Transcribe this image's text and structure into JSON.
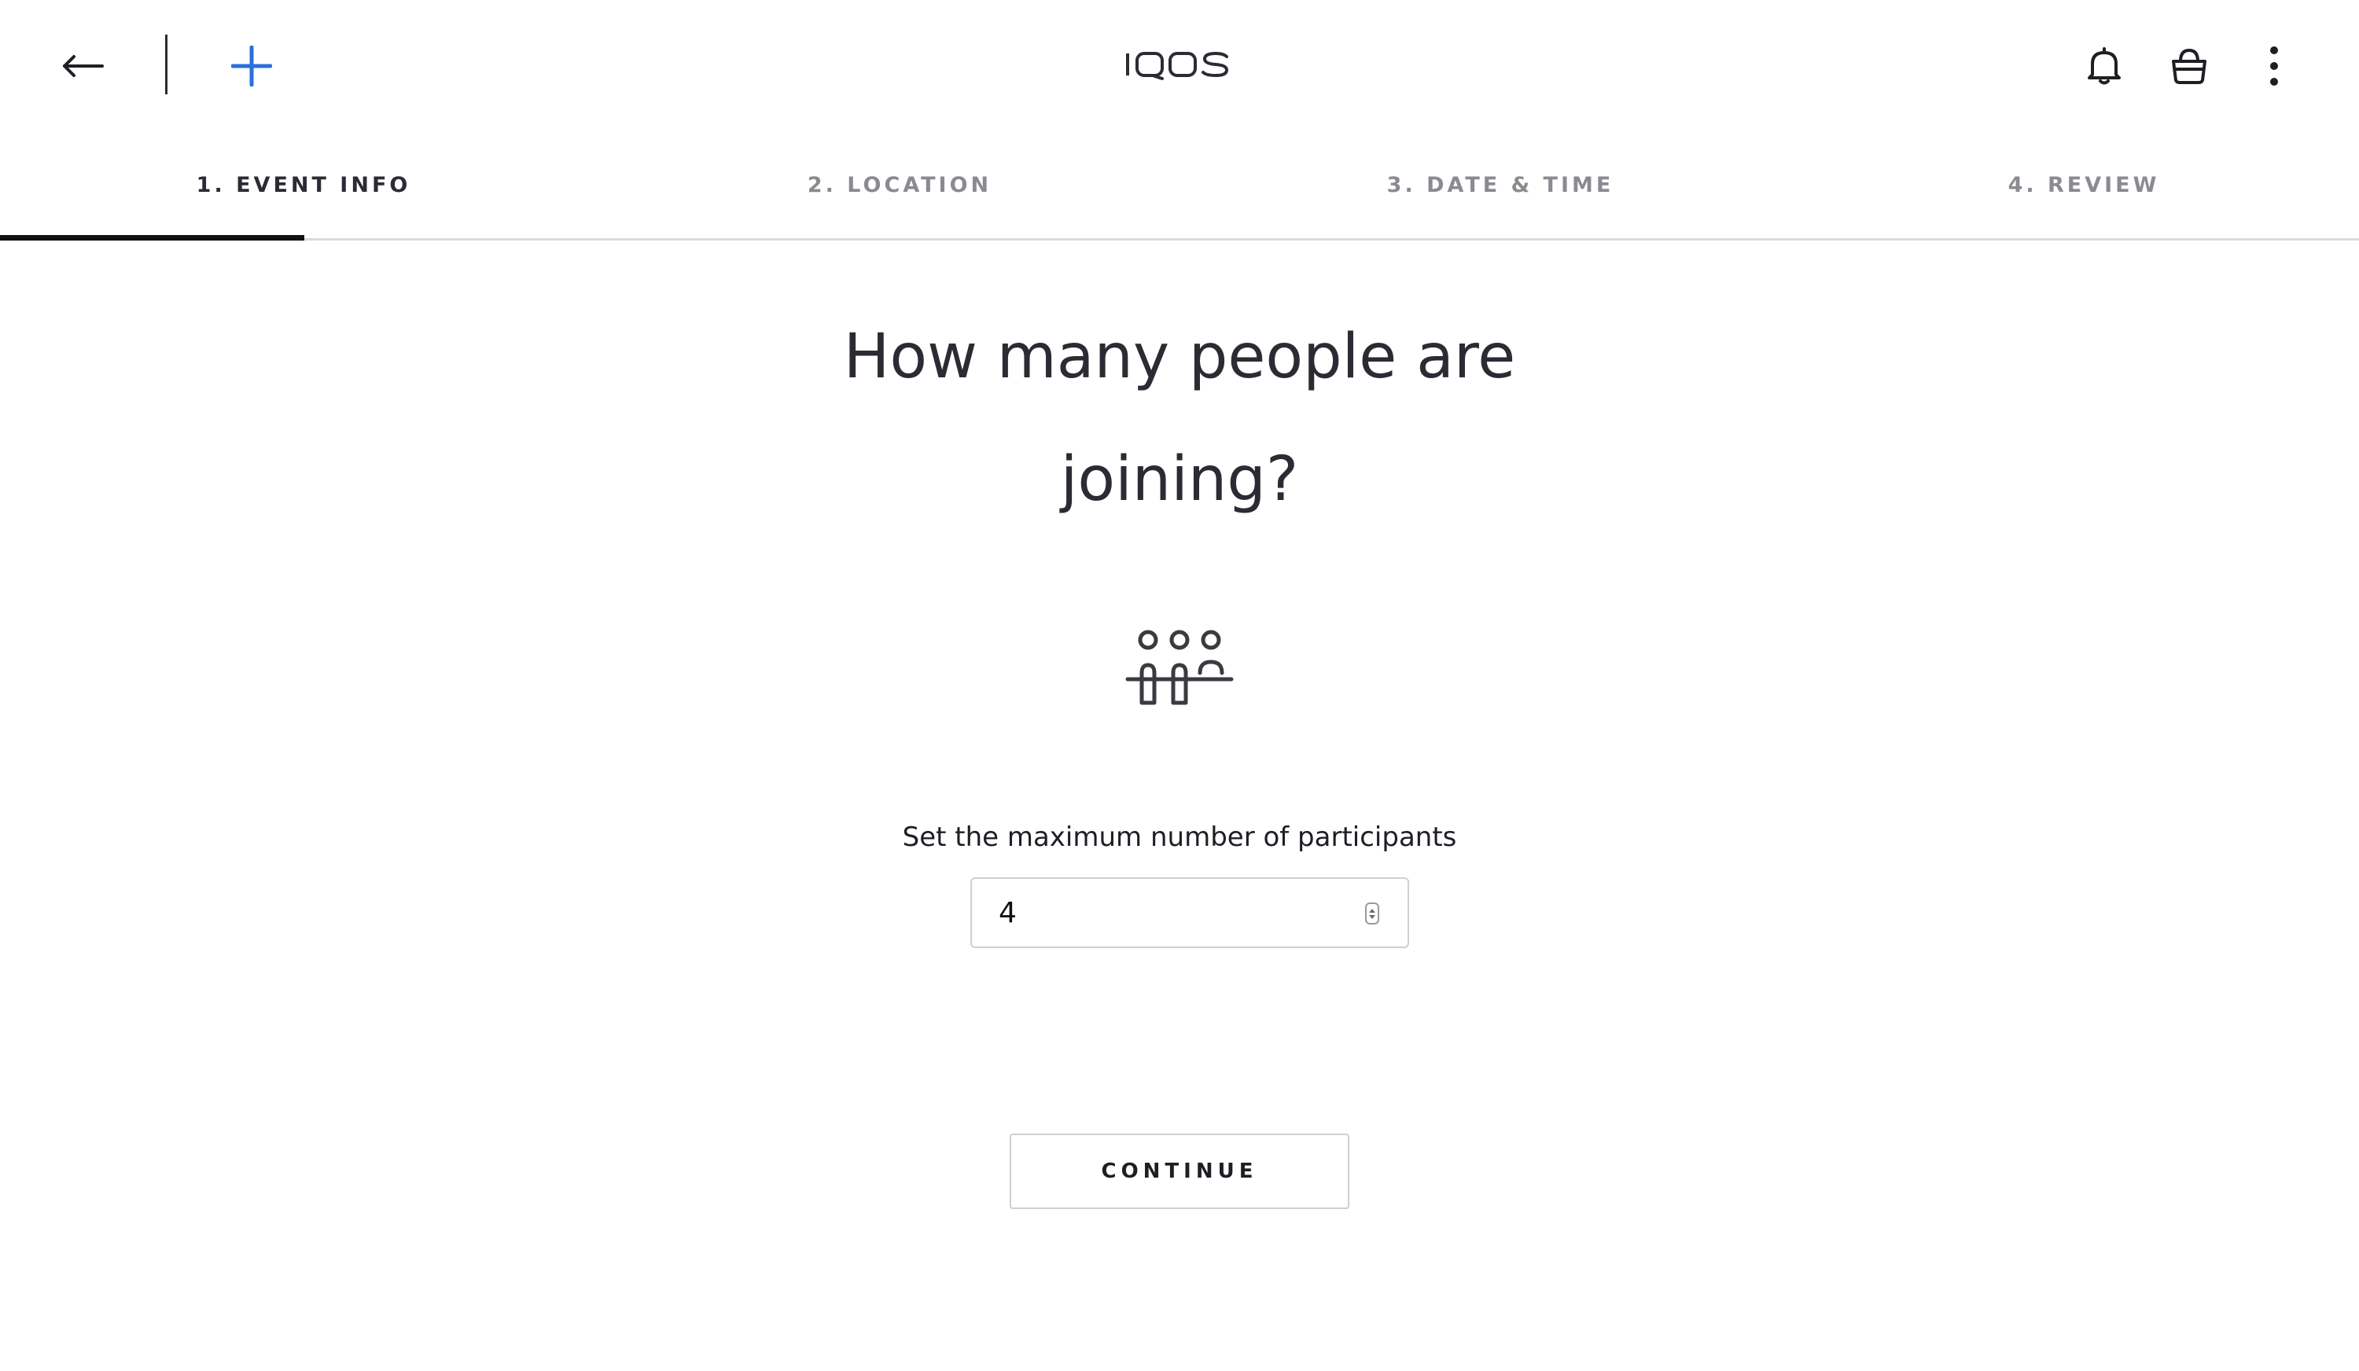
{
  "header": {
    "logo_text": "IQOS",
    "accent_color": "#2a6fdb",
    "left_icons": [
      "back-arrow-icon",
      "plus-icon"
    ],
    "right_icons": [
      "bell-icon",
      "shopping-bag-icon",
      "more-vertical-icon"
    ]
  },
  "steps": {
    "items": [
      {
        "label": "1. EVENT INFO",
        "active": true
      },
      {
        "label": "2. LOCATION",
        "active": false
      },
      {
        "label": "3. DATE & TIME",
        "active": false
      },
      {
        "label": "4. REVIEW",
        "active": false
      }
    ],
    "progress_fraction": 0.25
  },
  "main": {
    "question_line1": "How many people are",
    "question_line2": "joining?",
    "illustration_icon": "group-of-people-icon",
    "field_label": "Set the maximum number of participants",
    "participants_value": "4",
    "continue_label": "CONTINUE"
  }
}
